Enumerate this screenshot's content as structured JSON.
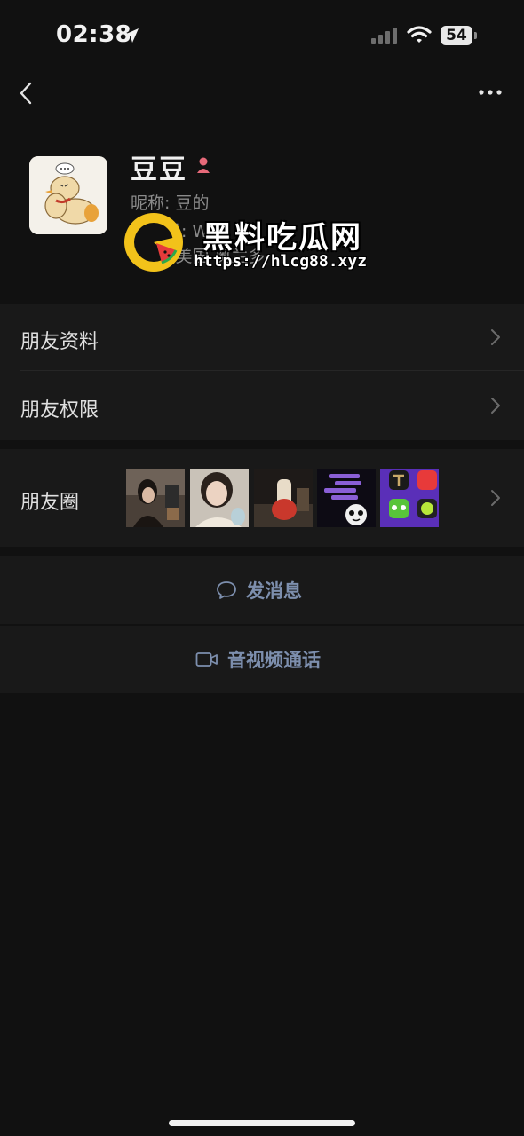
{
  "status_bar": {
    "time": "02:38",
    "battery": "54"
  },
  "nav": {
    "back_icon": "chevron-left",
    "more_icon": "ellipsis-horizontal"
  },
  "profile": {
    "name": "豆豆",
    "nickname": "昵称: 豆的",
    "wechat_id": "微信号: W",
    "region": "地区: 美国 奥兰多",
    "gender_icon": "female-icon",
    "gender_color": "#e86a7a"
  },
  "watermark": {
    "title": "黑料吃瓜网",
    "url": "https://hlcg88.xyz"
  },
  "menu": {
    "friend_info": "朋友资料",
    "friend_permissions": "朋友权限",
    "moments": "朋友圈"
  },
  "actions": {
    "send_message": "发消息",
    "video_call": "音视频通话"
  },
  "colors": {
    "background": "#111111",
    "row_background": "#191919",
    "action_text": "#7d8fae"
  }
}
